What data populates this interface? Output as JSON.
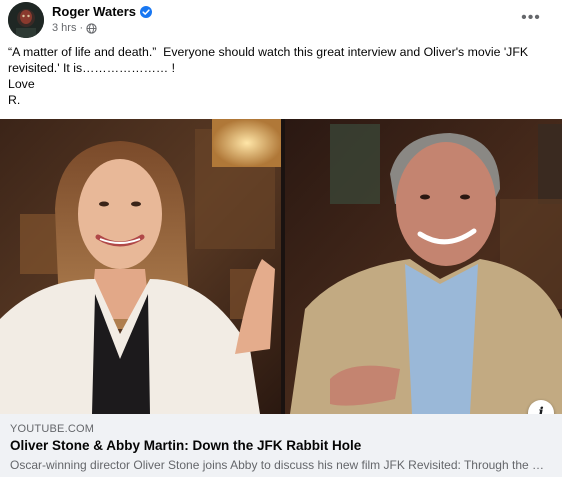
{
  "post": {
    "author": "Roger Waters",
    "timestamp": "3 hrs",
    "separator": "·",
    "privacy_icon": "globe-icon",
    "verified_icon": "verified-badge-icon",
    "more_label": "•••",
    "text_lines": [
      "“A matter of life and death.”  Everyone should watch this great interview and Oliver's movie 'JFK",
      "revisited.' It is………………… !",
      "Love",
      "R."
    ]
  },
  "link_preview": {
    "domain": "YOUTUBE.COM",
    "title": "Oliver Stone & Abby Martin: Down the JFK Rabbit Hole",
    "description": "Oscar-winning director Oliver Stone joins Abby to discuss his new film JFK Revisited: Through the Looking Glass",
    "info_label": "i"
  },
  "colors": {
    "secondary_text": "#65676b",
    "verified_blue": "#1877f2",
    "preview_bg": "#f0f2f5"
  }
}
